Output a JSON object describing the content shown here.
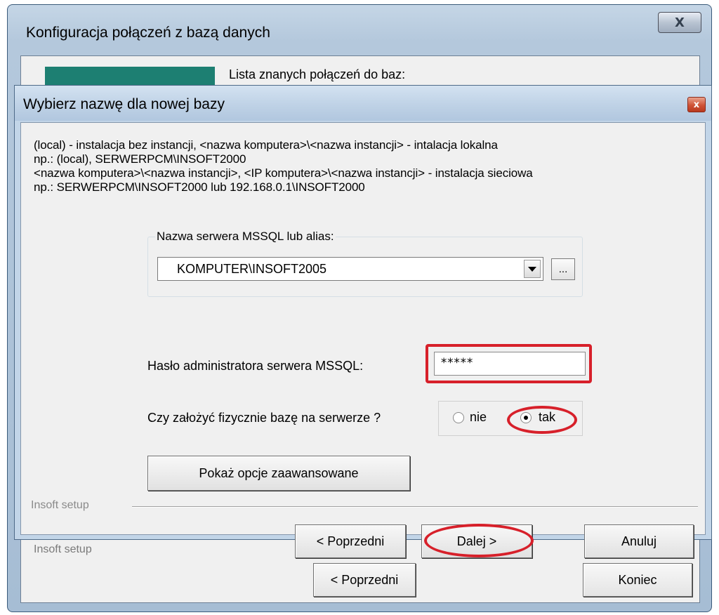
{
  "background_window": {
    "title": "Konfiguracja połączeń z bazą danych",
    "close_symbol": "X",
    "list_label": "Lista znanych połączeń do baz:",
    "setup_label": "Insoft setup",
    "prev_button": "< Poprzedni",
    "finish_button": "Koniec"
  },
  "dialog": {
    "title": "Wybierz nazwę dla nowej bazy",
    "close_symbol": "x",
    "info_lines": [
      "(local) - instalacja bez instancji,  <nazwa komputera>\\<nazwa instancji> - intalacja lokalna",
      "np.: (local),  SERWERPCM\\INSOFT2000",
      "<nazwa komputera>\\<nazwa instancji>,  <IP komputera>\\<nazwa instancji> - instalacja sieciowa",
      "np.: SERWERPCM\\INSOFT2000   lub  192.168.0.1\\INSOFT2000"
    ],
    "server_group_label": "Nazwa serwera MSSQL lub alias:",
    "server_value": "KOMPUTER\\INSOFT2005",
    "browse_button": "...",
    "password_label": "Hasło administratora serwera MSSQL:",
    "password_value": "*****",
    "create_db_label": "Czy założyć fizycznie bazę na serwerze ?",
    "radio_no": "nie",
    "radio_yes": "tak",
    "radio_selected": "tak",
    "advanced_button": "Pokaż opcje zaawansowane",
    "setup_label": "Insoft setup",
    "prev_button": "< Poprzedni",
    "next_button": "Dalej >",
    "cancel_button": "Anuluj"
  },
  "colors": {
    "highlight": "#d7202a",
    "header_band": "#1d7f72",
    "titlebar": "#c2d5e8"
  }
}
